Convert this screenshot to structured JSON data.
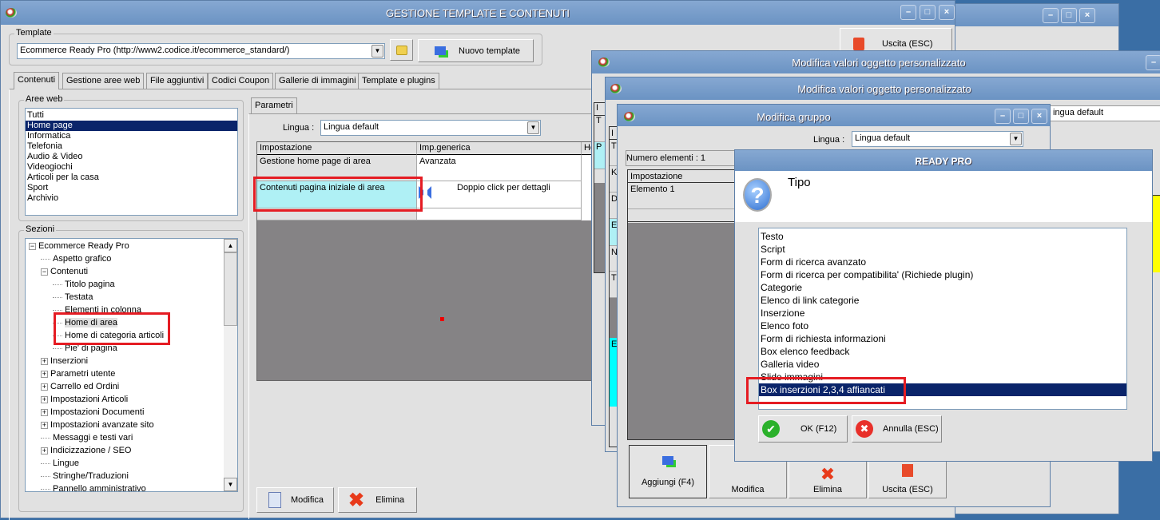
{
  "main": {
    "title": "GESTIONE TEMPLATE E CONTENUTI",
    "template_label": "Template",
    "template_value": "Ecommerce Ready Pro (http://www2.codice.it/ecommerce_standard/)",
    "new_template": "Nuovo template",
    "exit": "Uscita (ESC)",
    "tabs": [
      "Contenuti",
      "Gestione aree web",
      "File aggiuntivi",
      "Codici Coupon",
      "Gallerie di immagini",
      "Template e plugins"
    ],
    "aree_label": "Aree web",
    "aree": [
      "Tutti",
      "Home page",
      "Informatica",
      "Telefonia",
      "Audio & Video",
      "Videogiochi",
      "Articoli per la casa",
      "Sport",
      "Archivio"
    ],
    "sezioni_label": "Sezioni",
    "tree": [
      {
        "label": "Ecommerce Ready Pro",
        "level": 0,
        "toggle": "-"
      },
      {
        "label": "Aspetto grafico",
        "level": 1,
        "toggle": ""
      },
      {
        "label": "Contenuti",
        "level": 1,
        "toggle": "-"
      },
      {
        "label": "Titolo pagina",
        "level": 2,
        "toggle": ""
      },
      {
        "label": "Testata",
        "level": 2,
        "toggle": ""
      },
      {
        "label": "Elementi in colonna",
        "level": 2,
        "toggle": ""
      },
      {
        "label": "Home di area",
        "level": 2,
        "toggle": "",
        "selected": true
      },
      {
        "label": "Home di categoria articoli",
        "level": 2,
        "toggle": ""
      },
      {
        "label": "Pie' di pagina",
        "level": 2,
        "toggle": ""
      },
      {
        "label": "Inserzioni",
        "level": 1,
        "toggle": "+"
      },
      {
        "label": "Parametri utente",
        "level": 1,
        "toggle": "+"
      },
      {
        "label": "Carrello ed Ordini",
        "level": 1,
        "toggle": "+"
      },
      {
        "label": "Impostazioni Articoli",
        "level": 1,
        "toggle": "+"
      },
      {
        "label": "Impostazioni Documenti",
        "level": 1,
        "toggle": "+"
      },
      {
        "label": "Impostazioni avanzate sito",
        "level": 1,
        "toggle": "+"
      },
      {
        "label": "Messaggi e testi vari",
        "level": 1,
        "toggle": ""
      },
      {
        "label": "Indicizzazione / SEO",
        "level": 1,
        "toggle": "+"
      },
      {
        "label": "Lingue",
        "level": 1,
        "toggle": ""
      },
      {
        "label": "Stringhe/Traduzioni",
        "level": 1,
        "toggle": ""
      },
      {
        "label": "Pannello amministrativo",
        "level": 1,
        "toggle": ""
      }
    ],
    "param_tab": "Parametri",
    "lingua_label": "Lingua :",
    "lingua_value": "Lingua default",
    "grid_headers": [
      "Impostazione",
      "Imp.generica",
      "Ho"
    ],
    "grid_rows": [
      [
        "Gestione home page di area",
        "Avanzata"
      ],
      [
        "Contenuti pagina iniziale di area",
        "Doppio click per dettagli"
      ]
    ],
    "modifica": "Modifica",
    "elimina": "Elimina"
  },
  "win_a": {
    "title": "Modifica valori oggetto personalizzato"
  },
  "win_b": {
    "title": "Modifica valori oggetto personalizzato",
    "lingua_value": "ingua default",
    "col_letters": [
      "I",
      "T",
      "P"
    ]
  },
  "win_b_inner": {
    "col_letters": [
      "I",
      "T",
      "K",
      "D",
      "E",
      "N",
      "T",
      "E"
    ]
  },
  "gruppo": {
    "title": "Modifica gruppo",
    "lingua_label": "Lingua :",
    "lingua_value": "Lingua default",
    "count": "Numero elementi : 1",
    "header": "Impostazione",
    "row": "Elemento 1",
    "buttons": [
      "Aggiungi (F4)",
      "Modifica",
      "Elimina",
      "Uscita (ESC)"
    ]
  },
  "dialog": {
    "title": "READY PRO",
    "question": "Tipo",
    "options": [
      "Testo",
      "Script",
      "Form di ricerca avanzato",
      "Form di ricerca per compatibilita' (Richiede plugin)",
      "Categorie",
      "Elenco di link categorie",
      "Inserzione",
      "Elenco foto",
      "Form di richiesta informazioni",
      "Box elenco feedback",
      "Galleria video",
      "Slide immagini",
      "Box inserzioni 2,3,4 affiancati"
    ],
    "selected_index": 12,
    "ok": "OK (F12)",
    "cancel": "Annulla (ESC)"
  },
  "colors": {
    "titlebar": "#6b93c3",
    "selection": "#0a246a",
    "highlight_cell": "#aff0f5",
    "annotation": "#e51c23",
    "desktop": "#3a6ea5"
  }
}
